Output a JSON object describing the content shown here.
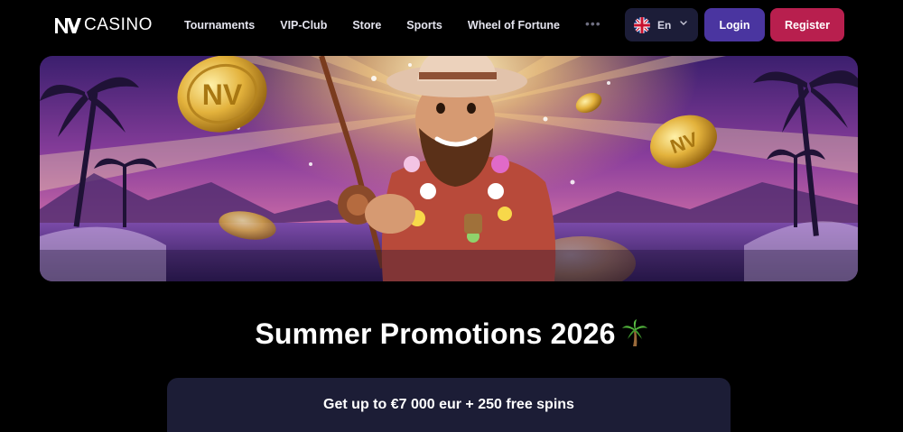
{
  "header": {
    "logo_text": "CASINO",
    "nav": [
      {
        "label": "Tournaments"
      },
      {
        "label": "VIP-Club"
      },
      {
        "label": "Store"
      },
      {
        "label": "Sports"
      },
      {
        "label": "Wheel of Fortune"
      }
    ],
    "more_label": "•••",
    "language": {
      "code": "En",
      "flag": "uk-flag-icon"
    },
    "login_label": "Login",
    "register_label": "Register"
  },
  "hero": {
    "image": "fisherman-cowboy-with-coins-banner",
    "coin_icon": "nv-coin-icon"
  },
  "promo": {
    "title": "Summer Promotions 2026",
    "title_icon": "palm-tree-icon",
    "offer_text": "Get up to €7 000 eur + 250 free spins"
  },
  "colors": {
    "background": "#000000",
    "login": "#4a35a0",
    "register": "#b81f4e",
    "language_bg": "#1c1d38",
    "promo_card": "#1c1d36",
    "coin_gold": "#e3b23c"
  }
}
